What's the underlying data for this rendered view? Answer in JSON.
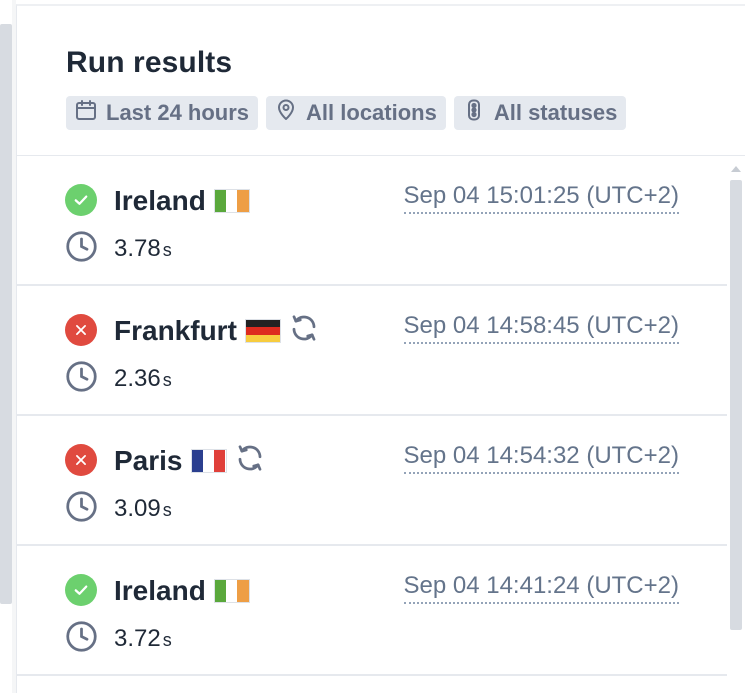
{
  "panel": {
    "title": "Run results",
    "filters": [
      {
        "label": "Last 24 hours",
        "icon": "calendar-icon"
      },
      {
        "label": "All locations",
        "icon": "location-pin-icon"
      },
      {
        "label": "All statuses",
        "icon": "traffic-light-icon"
      }
    ]
  },
  "results": [
    {
      "status": "success",
      "location": "Ireland",
      "flag": "IE",
      "retry": false,
      "timestamp": "Sep 04 15:01:25 (UTC+2)",
      "duration": "3.78",
      "unit": "s"
    },
    {
      "status": "failure",
      "location": "Frankfurt",
      "flag": "DE",
      "retry": true,
      "timestamp": "Sep 04 14:58:45 (UTC+2)",
      "duration": "2.36",
      "unit": "s"
    },
    {
      "status": "failure",
      "location": "Paris",
      "flag": "FR",
      "retry": true,
      "timestamp": "Sep 04 14:54:32 (UTC+2)",
      "duration": "3.09",
      "unit": "s"
    },
    {
      "status": "success",
      "location": "Ireland",
      "flag": "IE",
      "retry": false,
      "timestamp": "Sep 04 14:41:24 (UTC+2)",
      "duration": "3.72",
      "unit": "s"
    }
  ],
  "colors": {
    "success": "#6cd06e",
    "failure": "#e04a3f",
    "chip_bg": "#e5e9ef"
  }
}
